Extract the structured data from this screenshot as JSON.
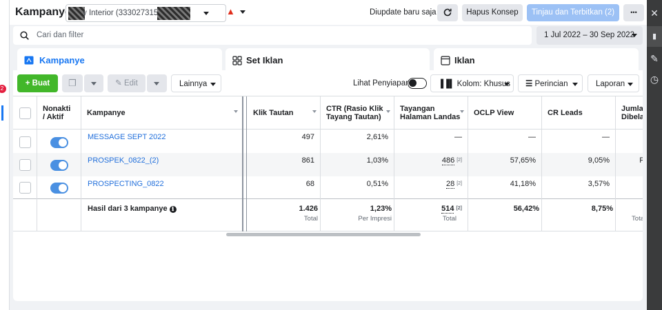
{
  "header": {
    "title": "Kampanye",
    "account_text": "y Interior (33302731570",
    "updated_text": "Diupdate baru saja",
    "discard_label": "Hapus Konsep",
    "review_label": "Tinjau dan Terbitkan (2)",
    "more_label": "•••"
  },
  "search": {
    "placeholder": "Cari dan filter"
  },
  "date_range": "1 Jul 2022 – 30 Sep 2022",
  "tabs": [
    {
      "label": "Kampanye",
      "active": true
    },
    {
      "label": "Set Iklan",
      "active": false
    },
    {
      "label": "Iklan",
      "active": false
    }
  ],
  "toolbar": {
    "create_label": "Buat",
    "edit_label": "Edit",
    "more_label": "Lainnya",
    "preview_label": "Lihat Penyiapan",
    "columns_label": "Kolom: Khusus",
    "breakdown_label": "Perincian",
    "reports_label": "Laporan"
  },
  "columns": {
    "toggle": [
      "Nonakti",
      "/ Aktif"
    ],
    "campaign": "Kampanye",
    "link_clicks": "Klik Tautan",
    "ctr": [
      "CTR (Rasio Klik",
      "Tayang Tautan)"
    ],
    "lpv": [
      "Tayangan",
      "Halaman Landas"
    ],
    "oclp": "OCLP View",
    "cr_leads": "CR Leads",
    "purchased": [
      "Jumlah",
      "Dibelan"
    ]
  },
  "rows": [
    {
      "name": "MESSAGE SEPT 2022",
      "active": true,
      "link_clicks": "497",
      "ctr": "2,61%",
      "lpv": "—",
      "lpv_note": "",
      "oclp": "—",
      "cr_leads": "—",
      "purchased": ""
    },
    {
      "name": "PROSPEK_0822_(2)",
      "active": true,
      "link_clicks": "861",
      "ctr": "1,03%",
      "lpv": "486",
      "lpv_note": "[2]",
      "oclp": "57,65%",
      "cr_leads": "9,05%",
      "purchased": "F"
    },
    {
      "name": "PROSPECTING_0822",
      "active": true,
      "link_clicks": "68",
      "ctr": "0,51%",
      "lpv": "28",
      "lpv_note": "[2]",
      "oclp": "41,18%",
      "cr_leads": "3,57%",
      "purchased": ""
    }
  ],
  "summary": {
    "label": "Hasil dari 3 kampanye",
    "info_icon": "ℹ",
    "link_clicks": "1.426",
    "link_clicks_sub": "Total",
    "ctr": "1,23%",
    "ctr_sub": "Per Impresi",
    "lpv": "514",
    "lpv_note": "[2]",
    "lpv_sub": "Total",
    "oclp": "56,42%",
    "cr_leads": "8,75%",
    "purchased_sub": "Tota"
  },
  "colors": {
    "accent": "#1877f2",
    "link": "#216fdb",
    "create_green": "#42b72a",
    "review_disabled_blue": "#9cc1f5",
    "toggle_on": "#4a90e2",
    "warning_red": "#e02d1b"
  }
}
